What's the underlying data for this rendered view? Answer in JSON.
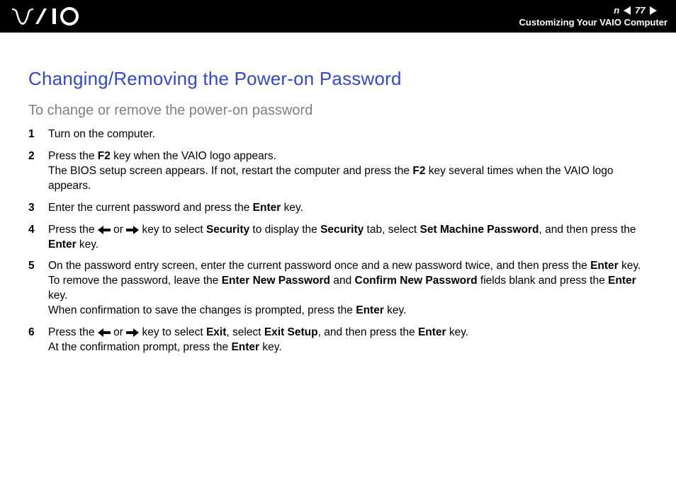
{
  "header": {
    "page_number": "77",
    "section": "Customizing Your VAIO Computer",
    "nav_prev_label": "Previous page",
    "nav_next_label": "Next page",
    "nav_n_text": "n",
    "logo_label": "VAIO"
  },
  "content": {
    "title": "Changing/Removing the Power-on Password",
    "subtitle": "To change or remove the power-on password",
    "steps": [
      {
        "num": "1",
        "segments": [
          {
            "t": "Turn on the computer."
          }
        ]
      },
      {
        "num": "2",
        "segments": [
          {
            "t": "Press the "
          },
          {
            "t": "F2",
            "b": true
          },
          {
            "t": " key when the VAIO logo appears."
          },
          {
            "br": true
          },
          {
            "t": "The BIOS setup screen appears. If not, restart the computer and press the "
          },
          {
            "t": "F2",
            "b": true
          },
          {
            "t": " key several times when the VAIO logo appears."
          }
        ]
      },
      {
        "num": "3",
        "segments": [
          {
            "t": "Enter the current password and press the "
          },
          {
            "t": "Enter",
            "b": true
          },
          {
            "t": " key."
          }
        ]
      },
      {
        "num": "4",
        "segments": [
          {
            "t": "Press the "
          },
          {
            "arrow": "left"
          },
          {
            "t": " or "
          },
          {
            "arrow": "right"
          },
          {
            "t": " key to select "
          },
          {
            "t": "Security",
            "b": true
          },
          {
            "t": " to display the "
          },
          {
            "t": "Security",
            "b": true
          },
          {
            "t": " tab, select "
          },
          {
            "t": "Set Machine Password",
            "b": true
          },
          {
            "t": ", and then press the "
          },
          {
            "t": "Enter",
            "b": true
          },
          {
            "t": " key."
          }
        ]
      },
      {
        "num": "5",
        "segments": [
          {
            "t": "On the password entry screen, enter the current password once and a new password twice, and then press the "
          },
          {
            "t": "Enter",
            "b": true
          },
          {
            "t": " key."
          },
          {
            "br": true
          },
          {
            "t": "To remove the password, leave the "
          },
          {
            "t": "Enter New Password",
            "b": true
          },
          {
            "t": " and "
          },
          {
            "t": "Confirm New Password",
            "b": true
          },
          {
            "t": " fields blank and press the "
          },
          {
            "t": "Enter",
            "b": true
          },
          {
            "t": " key."
          },
          {
            "br": true
          },
          {
            "t": "When confirmation to save the changes is prompted, press the "
          },
          {
            "t": "Enter",
            "b": true
          },
          {
            "t": " key."
          }
        ]
      },
      {
        "num": "6",
        "segments": [
          {
            "t": "Press the "
          },
          {
            "arrow": "left"
          },
          {
            "t": " or "
          },
          {
            "arrow": "right"
          },
          {
            "t": " key to select "
          },
          {
            "t": "Exit",
            "b": true
          },
          {
            "t": ", select "
          },
          {
            "t": "Exit Setup",
            "b": true
          },
          {
            "t": ", and then press the "
          },
          {
            "t": "Enter",
            "b": true
          },
          {
            "t": " key."
          },
          {
            "br": true
          },
          {
            "t": "At the confirmation prompt, press the "
          },
          {
            "t": "Enter",
            "b": true
          },
          {
            "t": " key."
          }
        ]
      }
    ]
  }
}
